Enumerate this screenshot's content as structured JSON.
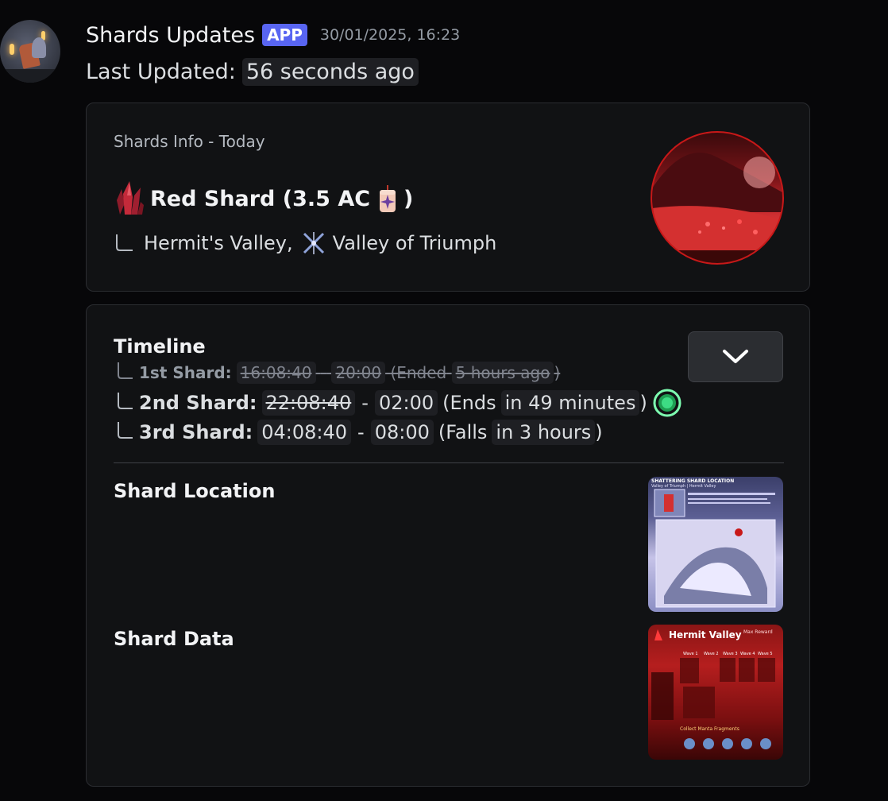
{
  "message": {
    "username": "Shards Updates",
    "badge": "APP",
    "timestamp": "30/01/2025, 16:23",
    "last_updated_label": "Last Updated:",
    "last_updated_value": "56 seconds ago"
  },
  "info_embed": {
    "author": "Shards Info - Today",
    "title_main": "Red Shard (3.5 AC",
    "title_close": ")",
    "location_part1": "Hermit's Valley,",
    "location_part2": "Valley of Triumph"
  },
  "timeline_embed": {
    "title": "Timeline",
    "rows": [
      {
        "label": "1st Shard:",
        "start": "16:08:40",
        "dash": "-",
        "end": "20:00",
        "status_open": "(Ended",
        "relative": "5 hours ago",
        "status_close": ")"
      },
      {
        "label": "2nd Shard:",
        "start": "22:08:40",
        "dash": "-",
        "end": "02:00",
        "status_open": "(Ends",
        "relative": "in 49 minutes",
        "status_close": ")"
      },
      {
        "label": "3rd Shard:",
        "start": "04:08:40",
        "dash": "-",
        "end": "08:00",
        "status_open": "(Falls",
        "relative": "in 3 hours",
        "status_close": ")"
      }
    ],
    "field_location": "Shard Location",
    "field_data": "Shard Data",
    "map_image_title": "SHATTERING SHARD LOCATION",
    "map_image_sub": "Valley of Triumph | Hermit Valley",
    "data_image_title": "Hermit Valley",
    "data_image_reward": "Max Reward",
    "data_image_waves": [
      "Wave 1",
      "Wave 2",
      "Wave 3",
      "Wave 4",
      "Wave 5"
    ],
    "data_image_footer": "Collect Manta Fragments"
  },
  "colors": {
    "badge": "#5865f2",
    "background": "#070709",
    "embed": "#111214",
    "live": "#3ddc84"
  },
  "icons": [
    "crystal-icon",
    "candle-icon",
    "branch-icon",
    "triumph-icon",
    "chevron-down-icon",
    "live-indicator-icon"
  ]
}
